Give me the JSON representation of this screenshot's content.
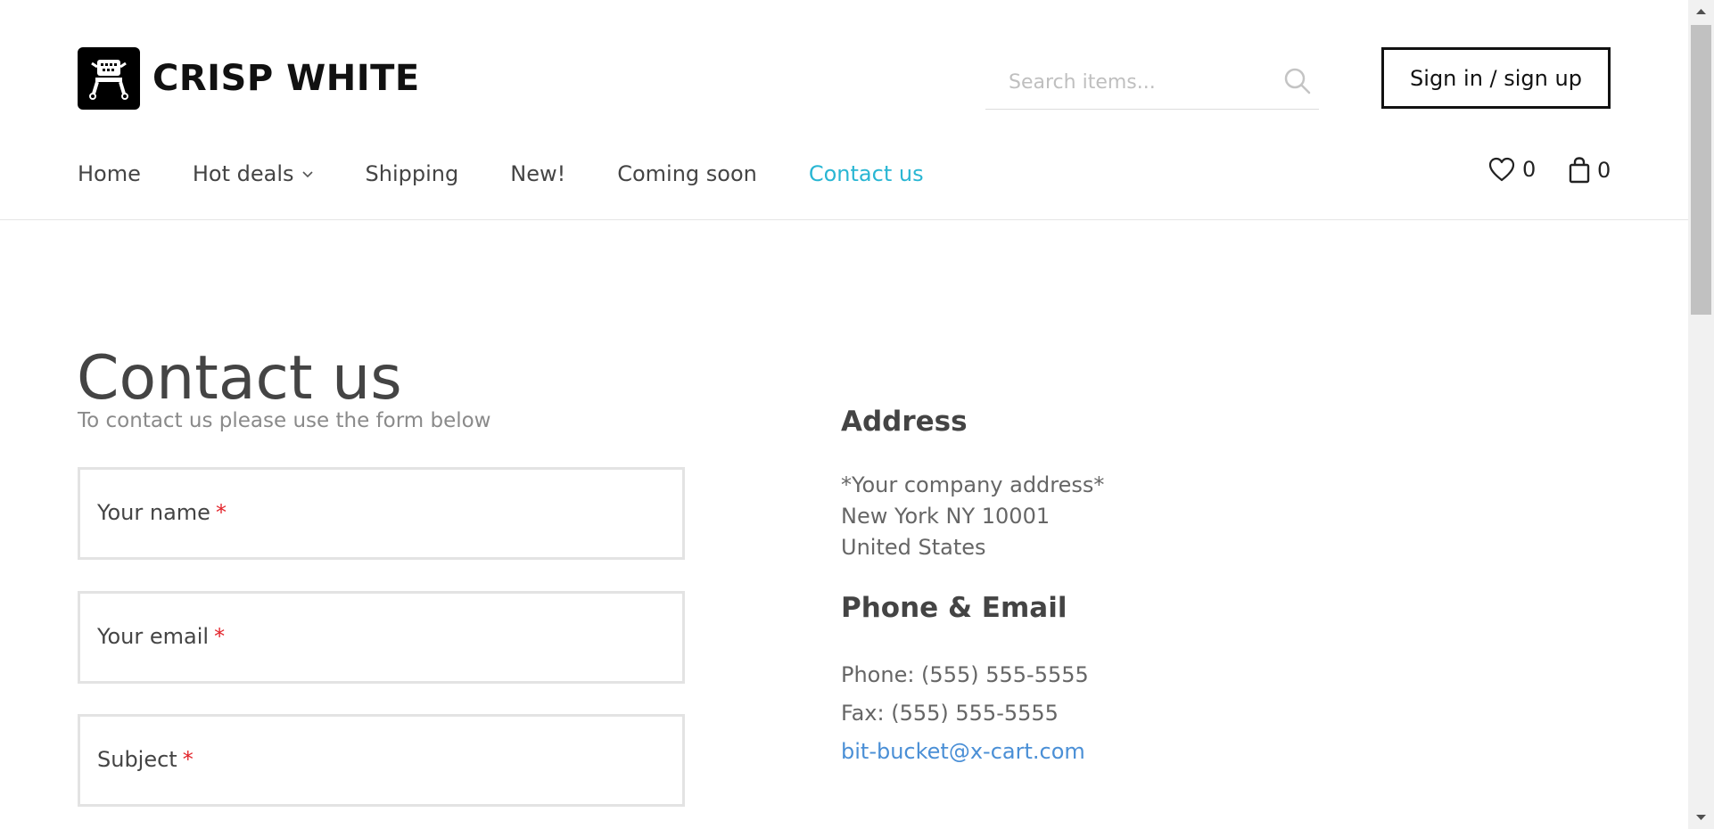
{
  "header": {
    "logo_text": "CRISP WHITE",
    "search_placeholder": "Search items...",
    "signin_label": "Sign in / sign up",
    "wishlist_count": "0",
    "cart_count": "0"
  },
  "nav": {
    "items": [
      {
        "label": "Home"
      },
      {
        "label": "Hot deals"
      },
      {
        "label": "Shipping"
      },
      {
        "label": "New!"
      },
      {
        "label": "Coming soon"
      },
      {
        "label": "Contact us"
      }
    ],
    "active": "Contact us"
  },
  "main": {
    "title": "Contact us",
    "intro": "To contact us please use the form below",
    "form": {
      "name_label": "Your name",
      "email_label": "Your email",
      "subject_label": "Subject",
      "required_mark": "*"
    }
  },
  "sidebar": {
    "address_heading": "Address",
    "address_lines": [
      "*Your company address*",
      "New York NY 10001",
      "United States"
    ],
    "phone_heading": "Phone & Email",
    "phone": "Phone: (555) 555-5555",
    "fax": "Fax: (555) 555-5555",
    "email": "bit-bucket@x-cart.com"
  },
  "colors": {
    "accent": "#29b6d3",
    "link": "#4a8fd6",
    "required": "#e3242b"
  }
}
